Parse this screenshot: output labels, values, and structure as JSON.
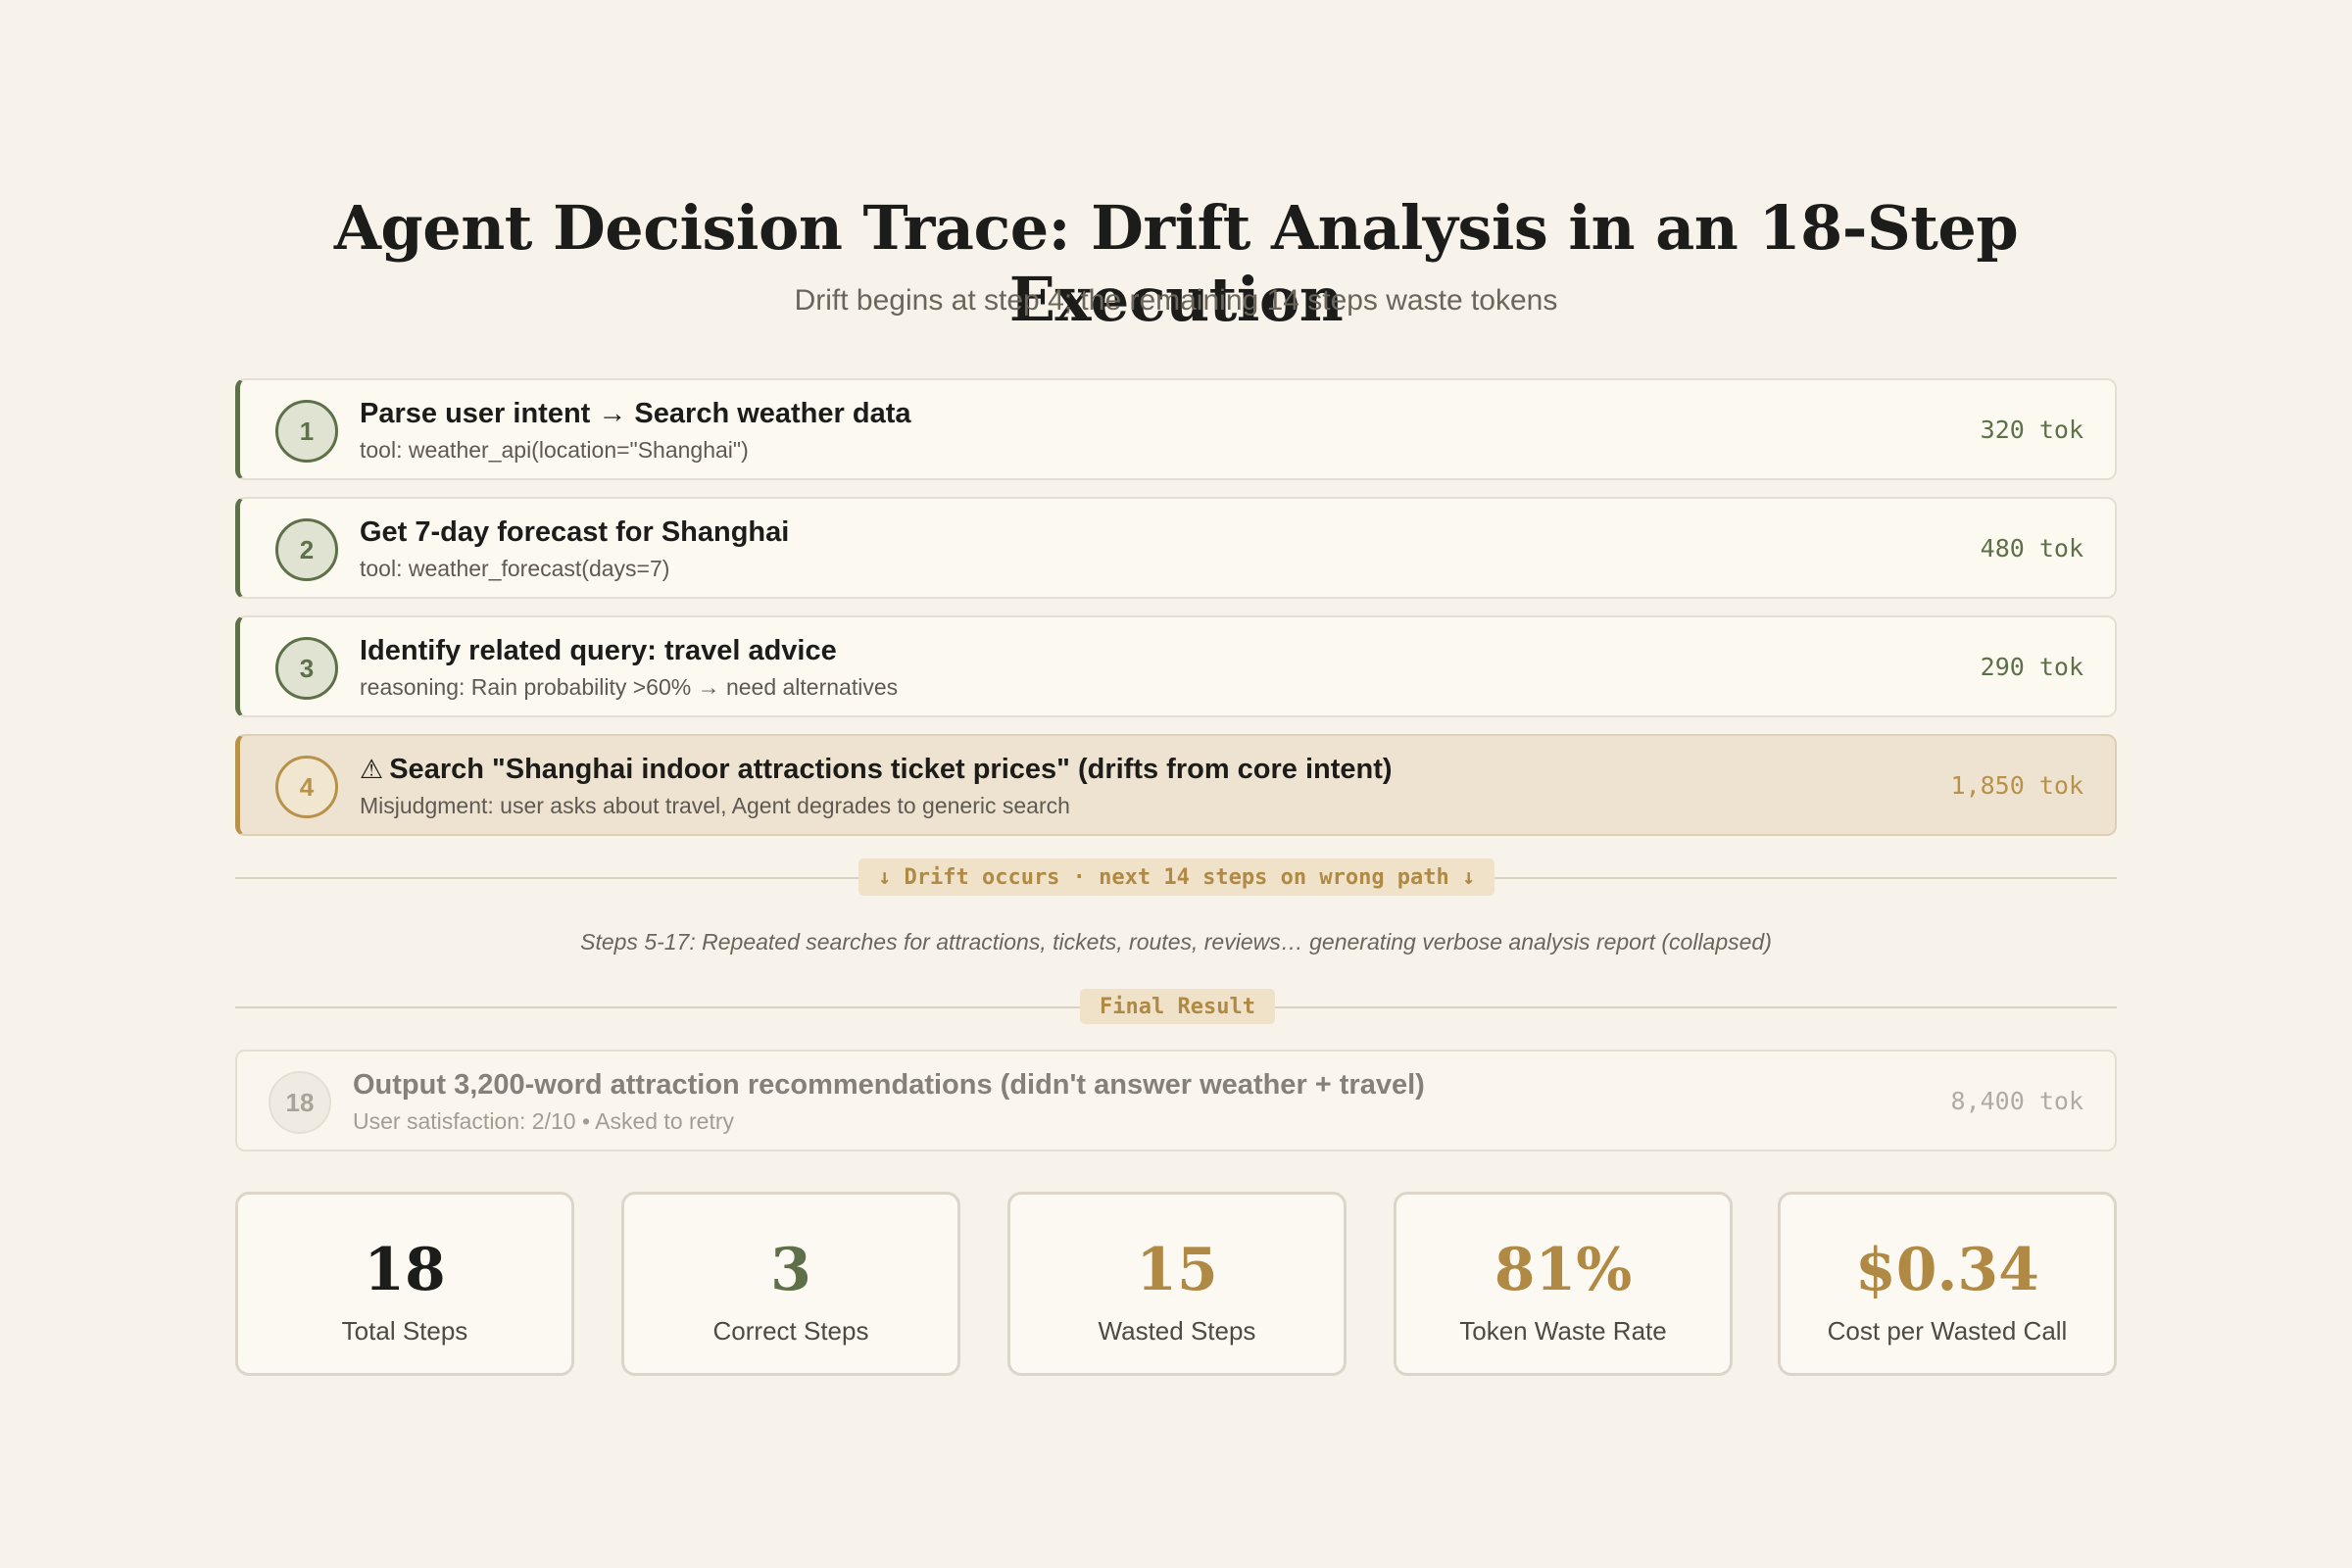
{
  "title": "Agent Decision Trace: Drift Analysis in an 18-Step Execution",
  "subtitle": "Drift begins at step 4; the remaining 14 steps waste tokens",
  "steps": [
    {
      "num": "1",
      "head": "Parse user intent → Search weather data",
      "detail": "tool: weather_api(location=\"Shanghai\")",
      "tokens": "320 tok"
    },
    {
      "num": "2",
      "head": "Get 7-day forecast for Shanghai",
      "detail": "tool: weather_forecast(days=7)",
      "tokens": "480 tok"
    },
    {
      "num": "3",
      "head": "Identify related query: travel advice",
      "detail": "reasoning: Rain probability >60% → need alternatives",
      "tokens": "290 tok"
    },
    {
      "num": "4",
      "icon": "⚠",
      "head": "Search \"Shanghai indoor attractions ticket prices\" (drifts from core intent)",
      "detail": "Misjudgment: user asks about travel, Agent degrades to generic search",
      "tokens": "1,850 tok"
    }
  ],
  "drift_label": "↓ Drift occurs · next 14 steps on wrong path ↓",
  "collapsed_note": "Steps 5-17: Repeated searches for attractions, tickets, routes, reviews… generating verbose analysis report (collapsed)",
  "final_label": "Final Result",
  "final_step": {
    "num": "18",
    "head": "Output 3,200-word attraction recommendations (didn't answer weather + travel)",
    "detail": "User satisfaction: 2/10  •  Asked to retry",
    "tokens": "8,400 tok"
  },
  "stats": [
    {
      "value": "18",
      "label": "Total Steps",
      "color": "#1c1c1a"
    },
    {
      "value": "3",
      "label": "Correct Steps",
      "color": "#5d7049"
    },
    {
      "value": "15",
      "label": "Wasted Steps",
      "color": "#b08a45"
    },
    {
      "value": "81%",
      "label": "Token Waste Rate",
      "color": "#b08a45"
    },
    {
      "value": "$0.34",
      "label": "Cost per Wasted Call",
      "color": "#b08a45"
    }
  ],
  "colors": {
    "background": "#f7f3ea",
    "correct": "#5d7049",
    "drift": "#b8924a",
    "muted": "#a9a49a"
  }
}
